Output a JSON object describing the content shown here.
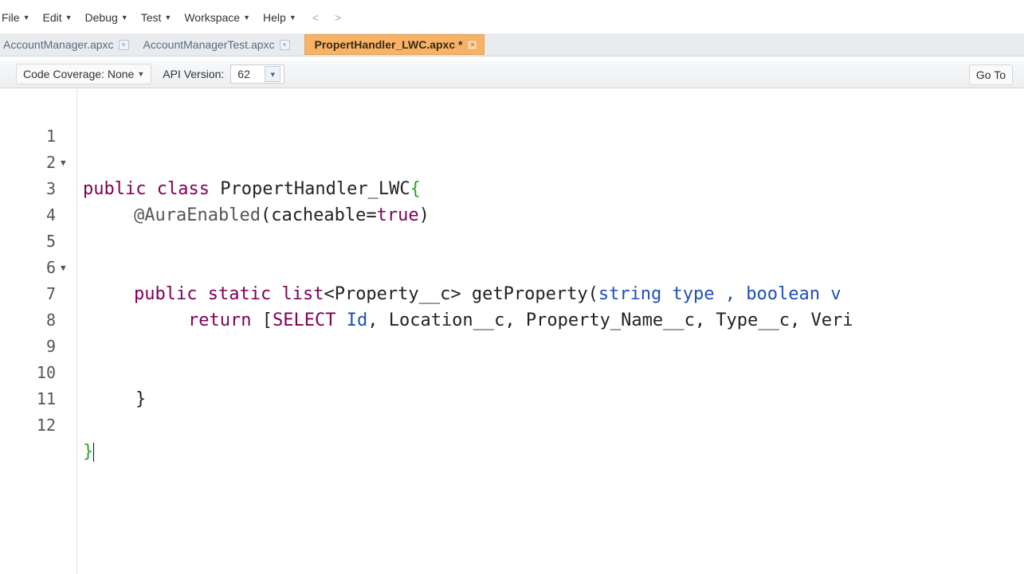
{
  "menu": {
    "items": [
      {
        "label": "File"
      },
      {
        "label": "Edit"
      },
      {
        "label": "Debug"
      },
      {
        "label": "Test"
      },
      {
        "label": "Workspace"
      },
      {
        "label": "Help"
      }
    ],
    "back": "<",
    "forward": ">"
  },
  "tabs": [
    {
      "label": "AccountManager.apxc",
      "active": false
    },
    {
      "label": "AccountManagerTest.apxc",
      "active": false
    },
    {
      "label": "PropertHandler_LWC.apxc *",
      "active": true
    }
  ],
  "toolbar": {
    "code_coverage": "Code Coverage: None",
    "api_label": "API Version:",
    "api_value": "62",
    "goto_label": "Go To"
  },
  "editor": {
    "line_numbers": [
      "1",
      "2",
      "3",
      "4",
      "5",
      "6",
      "7",
      "8",
      "9",
      "10",
      "11",
      "12"
    ],
    "lines": {
      "l1_kw1": "public",
      "l1_kw2": "class",
      "l1_name": "PropertHandler_LWC",
      "l1_brace": "{",
      "l3_ann": "@AuraEnabled",
      "l3_args": "(cacheable=",
      "l3_true": "true",
      "l3_close": ")",
      "l5_kw1": "public",
      "l5_kw2": "static",
      "l5_kw3": "list",
      "l5_generic": "<Property__c> getProperty(",
      "l5_t1": "string",
      "l5_p1": " type , ",
      "l5_t2": "boolean",
      "l5_p2": " v",
      "l7_kw": "return",
      "l7_b": " [",
      "l7_select": "SELECT",
      "l7_id": "Id",
      "l7_rest": ", Location__c, Property_Name__c, Type__c, Veri",
      "l10": "}",
      "l12": "}"
    }
  }
}
